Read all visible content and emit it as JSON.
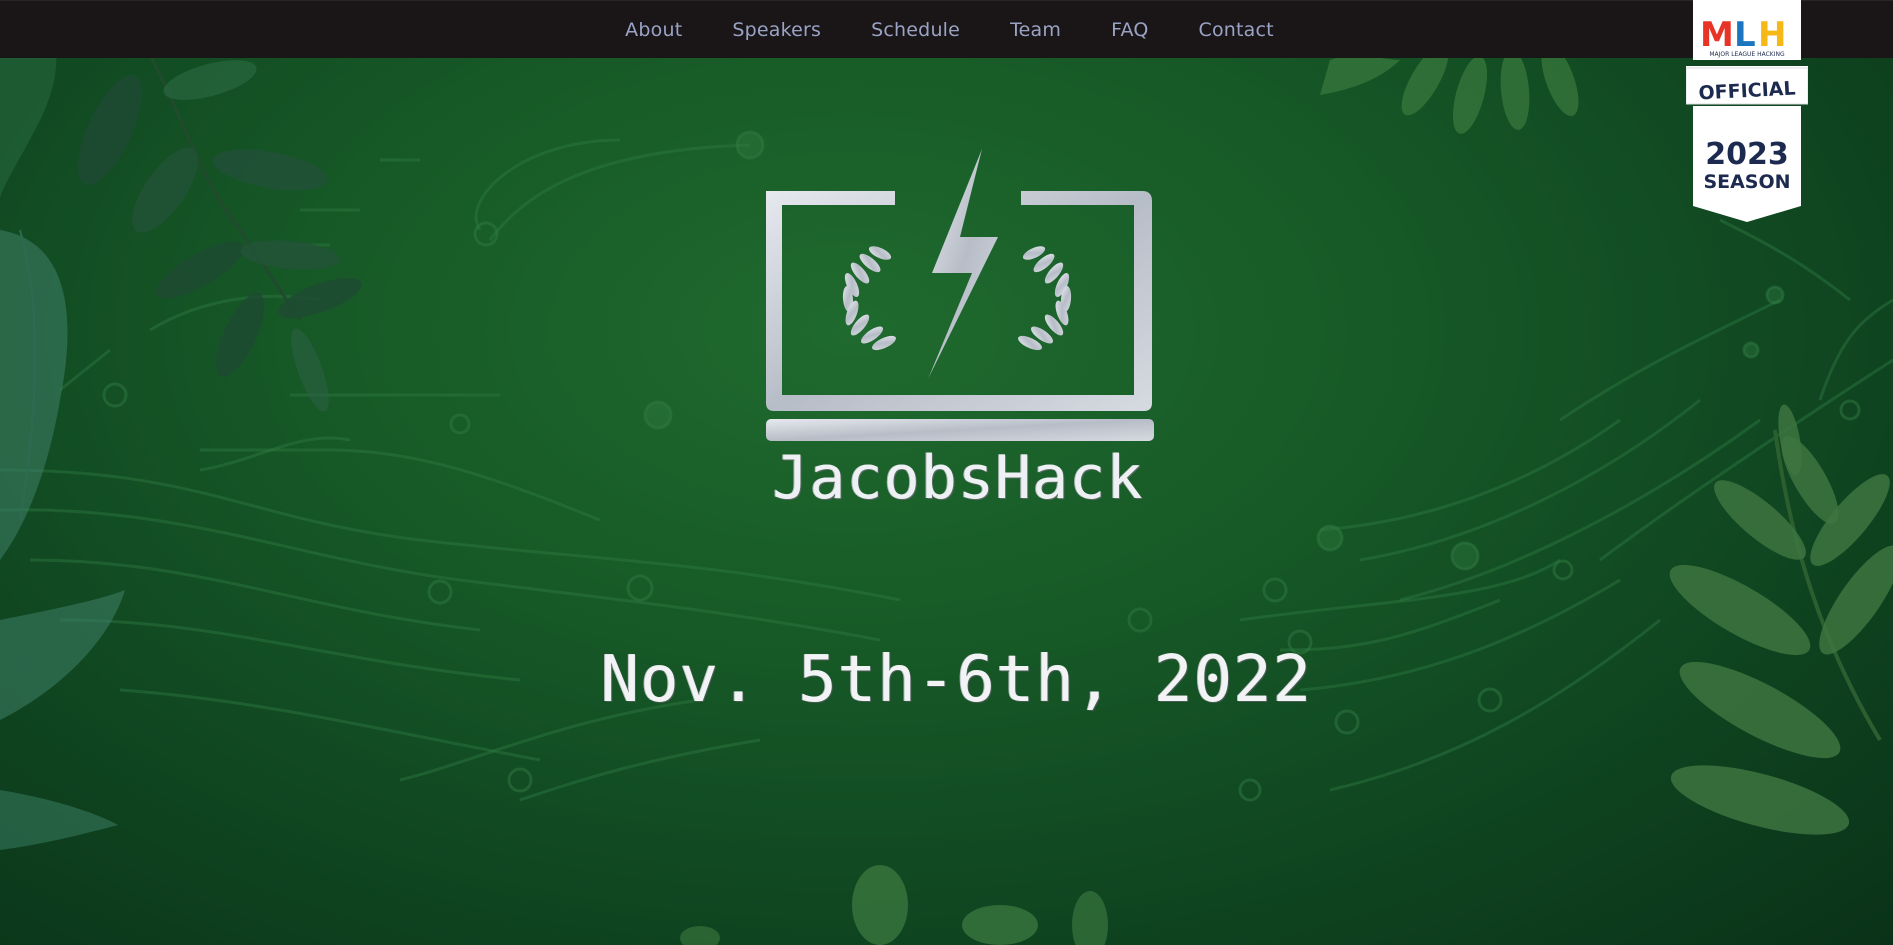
{
  "nav": {
    "items": [
      {
        "label": "About"
      },
      {
        "label": "Speakers"
      },
      {
        "label": "Schedule"
      },
      {
        "label": "Team"
      },
      {
        "label": "FAQ"
      },
      {
        "label": "Contact"
      }
    ]
  },
  "mlh_badge": {
    "logo_text": "MLH",
    "subtitle": "MAJOR LEAGUE HACKING",
    "ribbon": "OFFICIAL",
    "year": "2023",
    "season": "SEASON"
  },
  "hero": {
    "brand": "JacobsHack",
    "date": "Nov. 5th-6th, 2022"
  },
  "icons": [
    "laptop-icon",
    "lightning-bolt-icon",
    "laurel-icon"
  ],
  "colors": {
    "nav_bg": "#1a1617",
    "nav_link": "#9aa3c6",
    "bg_green": "#175a27",
    "logo_silver": "#c9ced6"
  }
}
